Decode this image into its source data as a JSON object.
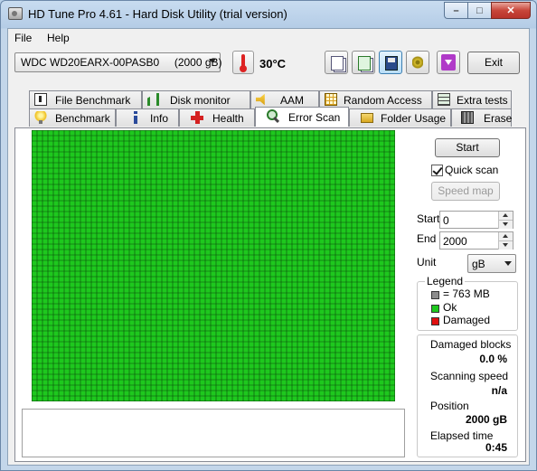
{
  "window": {
    "title": "HD Tune Pro 4.61 - Hard Disk Utility (trial version)",
    "min_glyph": "–",
    "max_glyph": "□",
    "close_glyph": "✕"
  },
  "menu": {
    "file": "File",
    "help": "Help"
  },
  "toolbar": {
    "drive": "WDC WD20EARX-00PASB0     (2000 gB)",
    "temperature": "30°C",
    "exit_label": "Exit"
  },
  "tabs_back": [
    {
      "label": "File Benchmark",
      "icon": "document-icon"
    },
    {
      "label": "Disk monitor",
      "icon": "bar-chart-icon"
    },
    {
      "label": "AAM",
      "icon": "speaker-icon"
    },
    {
      "label": "Random Access",
      "icon": "grid-icon"
    },
    {
      "label": "Extra tests",
      "icon": "table-icon"
    }
  ],
  "tabs_front": [
    {
      "label": "Benchmark",
      "icon": "lightbulb-icon"
    },
    {
      "label": "Info",
      "icon": "info-icon"
    },
    {
      "label": "Health",
      "icon": "cross-icon"
    },
    {
      "label": "Error Scan",
      "icon": "magnifier-icon",
      "active": true
    },
    {
      "label": "Folder Usage",
      "icon": "folder-icon"
    },
    {
      "label": "Erase",
      "icon": "trash-icon"
    }
  ],
  "scan": {
    "start_label": "Start",
    "quick_scan_label": "Quick scan",
    "quick_scan_checked": true,
    "speed_map_label": "Speed map",
    "start_field_label": "Start",
    "start_value": "0",
    "end_field_label": "End",
    "end_value": "2000",
    "unit_label": "Unit",
    "unit_value": "gB",
    "grid": {
      "columns": 67,
      "rows": 50,
      "block_color": "#1ec81e",
      "line_color": "#0a4a0a"
    }
  },
  "legend": {
    "title": "Legend",
    "items": [
      {
        "label": "= 763 MB",
        "color": "#8c8c8c"
      },
      {
        "label": "Ok",
        "color": "#1ec81e"
      },
      {
        "label": "Damaged",
        "color": "#e01010"
      }
    ]
  },
  "stats": {
    "damaged_label": "Damaged blocks",
    "damaged_value": "0.0 %",
    "speed_label": "Scanning speed",
    "speed_value": "n/a",
    "position_label": "Position",
    "position_value": "2000 gB",
    "elapsed_label": "Elapsed time",
    "elapsed_value": "0:45"
  }
}
